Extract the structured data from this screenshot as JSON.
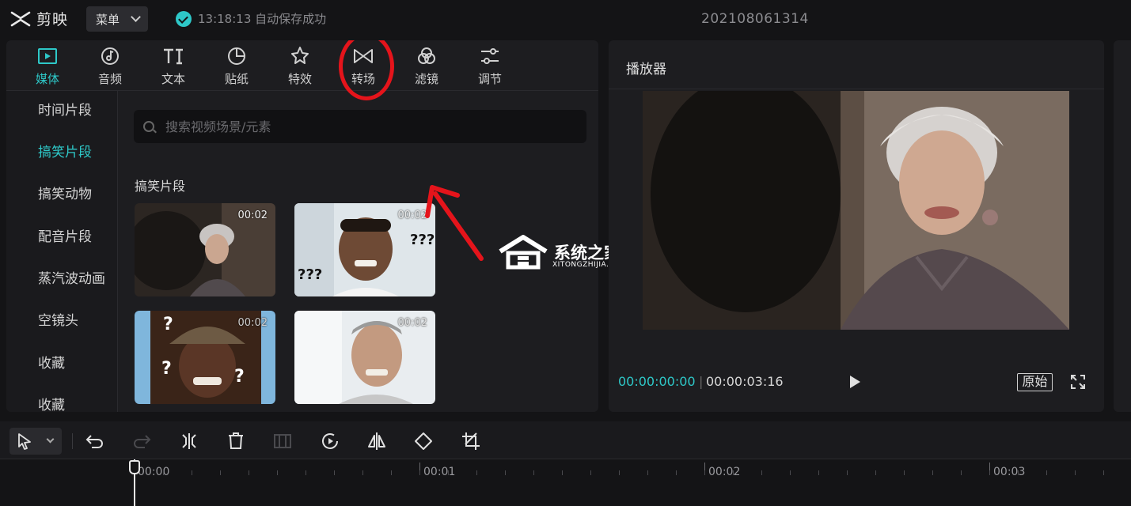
{
  "app": {
    "name": "剪映",
    "menu_label": "菜单",
    "autosave_text": "13:18:13 自动保存成功",
    "project_title": "202108061314"
  },
  "toolbar": {
    "items": [
      {
        "label": "媒体",
        "icon": "media-icon",
        "active": true
      },
      {
        "label": "音频",
        "icon": "audio-icon"
      },
      {
        "label": "文本",
        "icon": "text-icon"
      },
      {
        "label": "贴纸",
        "icon": "sticker-icon"
      },
      {
        "label": "特效",
        "icon": "effects-icon"
      },
      {
        "label": "转场",
        "icon": "transition-icon",
        "highlighted": true
      },
      {
        "label": "滤镜",
        "icon": "filter-icon"
      },
      {
        "label": "调节",
        "icon": "adjust-icon"
      }
    ]
  },
  "subnav": {
    "items": [
      {
        "label": "时间片段"
      },
      {
        "label": "搞笑片段",
        "active": true
      },
      {
        "label": "搞笑动物"
      },
      {
        "label": "配音片段"
      },
      {
        "label": "蒸汽波动画"
      },
      {
        "label": "空镜头"
      },
      {
        "label": "收藏"
      },
      {
        "label": "收藏"
      }
    ]
  },
  "search": {
    "placeholder": "搜索视频场景/元素"
  },
  "library": {
    "section_title": "搞笑片段",
    "clips": [
      {
        "duration": "00:02",
        "overlay_text": ""
      },
      {
        "duration": "00:02",
        "overlay_text": "???"
      },
      {
        "duration": "00:02",
        "overlay_text": "?"
      },
      {
        "duration": "00:02",
        "overlay_text": ""
      }
    ]
  },
  "watermark": {
    "title": "系统之家",
    "subtitle": "XITONGZHIJIA.NET"
  },
  "player": {
    "title": "播放器",
    "current_time": "00:00:00:00",
    "total_time": "00:00:03:16",
    "original_label": "原始"
  },
  "timeline": {
    "ticks": [
      "00:00",
      "00:01",
      "00:02",
      "00:03"
    ]
  },
  "colors": {
    "accent": "#2ec8c8",
    "annotation": "#e5141b",
    "panel": "#1d1d20",
    "background": "#141416"
  }
}
